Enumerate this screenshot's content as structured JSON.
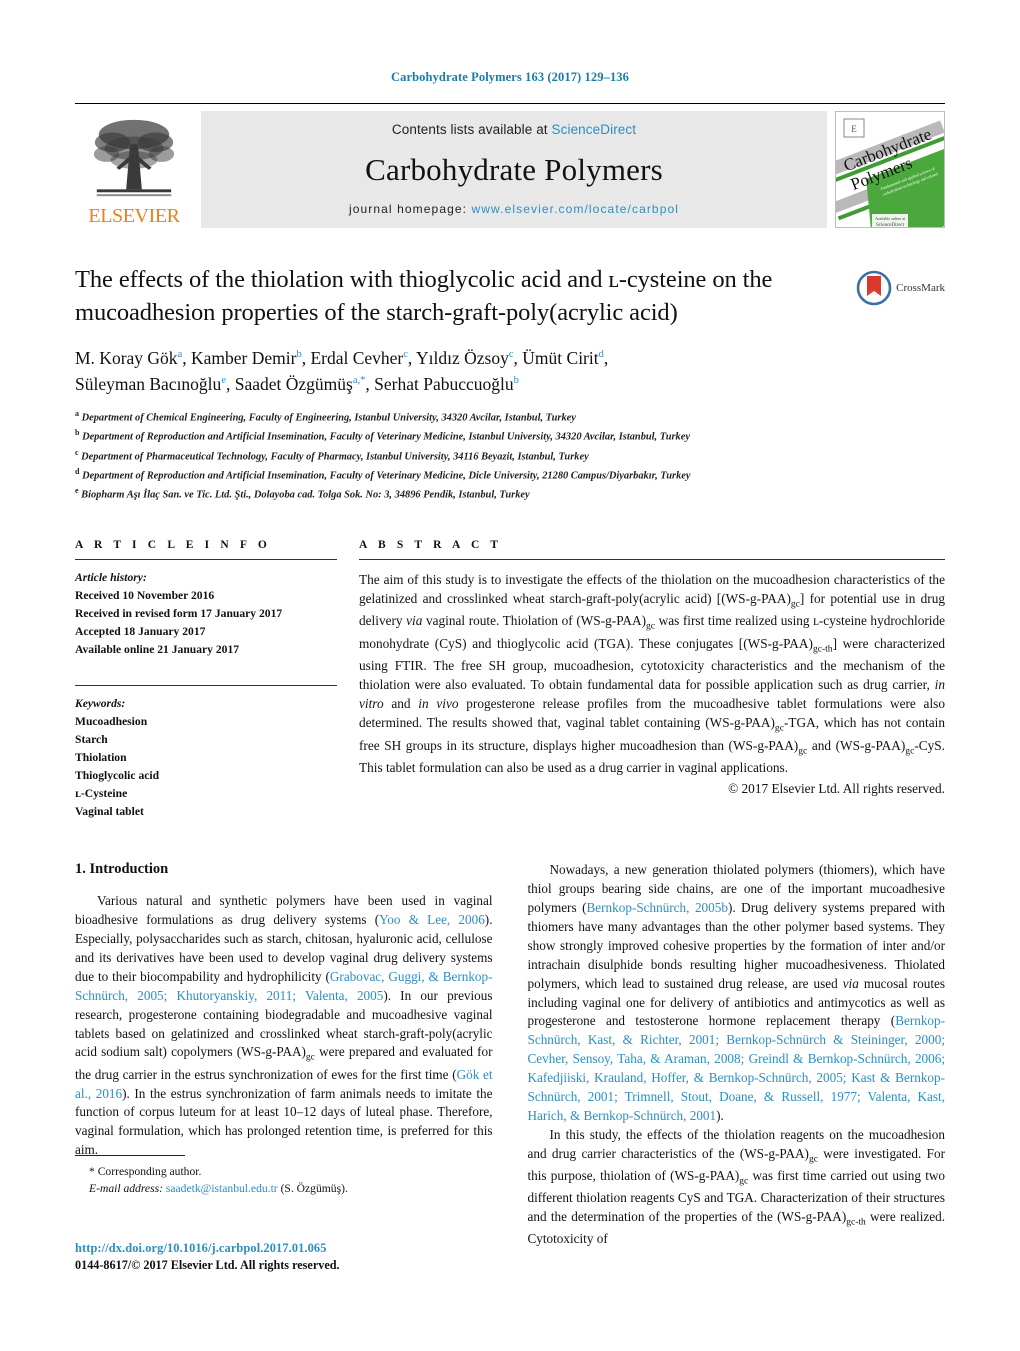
{
  "running_head": "Carbohydrate Polymers 163 (2017) 129–136",
  "masthead": {
    "contents_prefix": "Contents lists available at ",
    "sciencedirect": "ScienceDirect",
    "journal_name": "Carbohydrate Polymers",
    "homepage_prefix": "journal homepage: ",
    "homepage_url": "www.elsevier.com/locate/carbpol",
    "publisher": "ELSEVIER",
    "cover_title_line1": "Carbohydrate",
    "cover_title_line2": "Polymers",
    "colors": {
      "link": "#2a8fc4",
      "elsevier_orange": "#f07f13",
      "panel_grey": "#e8e8e8"
    }
  },
  "article": {
    "title": "The effects of the thiolation with thioglycolic acid and ʟ-cysteine on the mucoadhesion properties of the starch-graft-poly(acrylic acid)",
    "crossmark_label": "CrossMark",
    "authors_line1": "M. Koray Gök<sup>a</sup>, Kamber Demir<sup>b</sup>, Erdal Cevher<sup>c</sup>, Yıldız Özsoy<sup>c</sup>, Ümüt Cirit<sup>d</sup>,",
    "authors_line2": "Süleyman Bacınoğlu<sup>e</sup>, Saadet Özgümüş<sup>a,</sup><sup>*</sup>, Serhat Pabuccuoğlu<sup>b</sup>",
    "affiliations": [
      {
        "marker": "a",
        "text": "Department of Chemical Engineering, Faculty of Engineering, Istanbul University, 34320 Avcilar, Istanbul, Turkey"
      },
      {
        "marker": "b",
        "text": "Department of Reproduction and Artificial Insemination, Faculty of Veterinary Medicine, Istanbul University, 34320 Avcilar, Istanbul, Turkey"
      },
      {
        "marker": "c",
        "text": "Department of Pharmaceutical Technology, Faculty of Pharmacy, Istanbul University, 34116 Beyazit, Istanbul, Turkey"
      },
      {
        "marker": "d",
        "text": "Department of Reproduction and Artificial Insemination, Faculty of Veterinary Medicine, Dicle University, 21280 Campus/Diyarbakır, Turkey"
      },
      {
        "marker": "e",
        "text": "Biopharm Aşı İlaç San. ve Tic. Ltd. Şti., Dolayoba cad. Tolga Sok. No: 3, 34896 Pendik, Istanbul, Turkey"
      }
    ]
  },
  "article_info": {
    "heading": "A R T I C L E    I N F O",
    "history_label": "Article history:",
    "history": [
      "Received 10 November 2016",
      "Received in revised form 17 January 2017",
      "Accepted 18 January 2017",
      "Available online 21 January 2017"
    ],
    "keywords_label": "Keywords:",
    "keywords": [
      "Mucoadhesion",
      "Starch",
      "Thiolation",
      "Thioglycolic acid",
      "ʟ-Cysteine",
      "Vaginal tablet"
    ]
  },
  "abstract": {
    "heading": "A B S T R A C T",
    "text_html": "The aim of this study is to investigate the effects of the thiolation on the mucoadhesion characteristics of the gelatinized and crosslinked wheat starch-graft-poly(acrylic acid) [(WS-g-PAA)<sub>gc</sub>] for potential use in drug delivery <i>via</i> vaginal route. Thiolation of (WS-g-PAA)<sub>gc</sub> was first time realized using ʟ-cysteine hydrochloride monohydrate (CyS) and thioglycolic acid (TGA). These conjugates [(WS-g-PAA)<sub>gc-th</sub>] were characterized using FTIR. The free SH group, mucoadhesion, cytotoxicity characteristics and the mechanism of the thiolation were also evaluated. To obtain fundamental data for possible application such as drug carrier, <i>in vitro</i> and <i>in vivo</i> progesterone release profiles from the mucoadhesive tablet formulations were also determined. The results showed that, vaginal tablet containing (WS-g-PAA)<sub>gc</sub>-TGA, which has not contain free SH groups in its structure, displays higher mucoadhesion than (WS-g-PAA)<sub>gc</sub> and (WS-g-PAA)<sub>gc</sub>-CyS. This tablet formulation can also be used as a drug carrier in vaginal applications.",
    "copyright": "© 2017 Elsevier Ltd. All rights reserved."
  },
  "introduction": {
    "heading": "1. Introduction",
    "left_paragraphs_html": [
      "Various natural and synthetic polymers have been used in vaginal bioadhesive formulations as drug delivery systems (<span class=\"ref\">Yoo &amp; Lee, 2006</span>). Especially, polysaccharides such as starch, chitosan, hyaluronic acid, cellulose and its derivatives have been used to develop vaginal drug delivery systems due to their biocompability and hydrophilicity (<span class=\"ref\">Grabovac, Guggi, &amp; Bernkop-Schnürch, 2005; Khutoryanskiy, 2011; Valenta, 2005</span>). In our previous research, progesterone containing biodegradable and mucoadhesive vaginal tablets based on gelatinized and crosslinked wheat starch-graft-poly(acrylic acid sodium salt) copolymers (WS-g-PAA)<sub>gc</sub> were prepared and evaluated for the drug carrier in the estrus synchronization of ewes for the first time (<span class=\"ref\">Gök et al., 2016</span>). In the estrus synchronization of farm animals needs to imitate the function of corpus luteum for at least 10–12 days of luteal phase. Therefore, vaginal formulation, which has prolonged retention time, is preferred for this aim."
    ],
    "right_paragraphs_html": [
      "Nowadays, a new generation thiolated polymers (thiomers), which have thiol groups bearing side chains, are one of the important mucoadhesive polymers (<span class=\"ref\">Bernkop-Schnürch, 2005b</span>). Drug delivery systems prepared with thiomers have many advantages than the other polymer based systems. They show strongly improved cohesive properties by the formation of inter and/or intrachain disulphide bonds resulting higher mucoadhesiveness. Thiolated polymers, which lead to sustained drug release, are used <i>via</i> mucosal routes including vaginal one for delivery of antibiotics and antimycotics as well as progesterone and testosterone hormone replacement therapy (<span class=\"ref\">Bernkop-Schnürch, Kast, &amp; Richter, 2001; Bernkop-Schnürch &amp; Steininger, 2000; Cevher, Sensoy, Taha, &amp; Araman, 2008; Greindl &amp; Bernkop-Schnürch, 2006; Kafedjiiski, Krauland, Hoffer, &amp; Bernkop-Schnürch, 2005; Kast &amp; Bernkop-Schnürch, 2001; Trimnell, Stout, Doane, &amp; Russell, 1977; Valenta, Kast, Harich, &amp; Bernkop-Schnürch, 2001</span>).",
      "In this study, the effects of the thiolation reagents on the mucoadhesion and drug carrier characteristics of the (WS-g-PAA)<sub>gc</sub> were investigated. For this purpose, thiolation of (WS-g-PAA)<sub>gc</sub> was first time carried out using two different thiolation reagents CyS and TGA. Characterization of their structures and the determination of the properties of the (WS-g-PAA)<sub>gc-th</sub> were realized. Cytotoxicity of"
    ]
  },
  "footer": {
    "corresponding_marker": "*",
    "corresponding_text": "Corresponding author.",
    "email_label": "E-mail address:",
    "email": "saadetk@istanbul.edu.tr",
    "email_owner": "(S. Özgümüş).",
    "doi": "http://dx.doi.org/10.1016/j.carbpol.2017.01.065",
    "issn_line": "0144-8617/© 2017 Elsevier Ltd. All rights reserved."
  }
}
